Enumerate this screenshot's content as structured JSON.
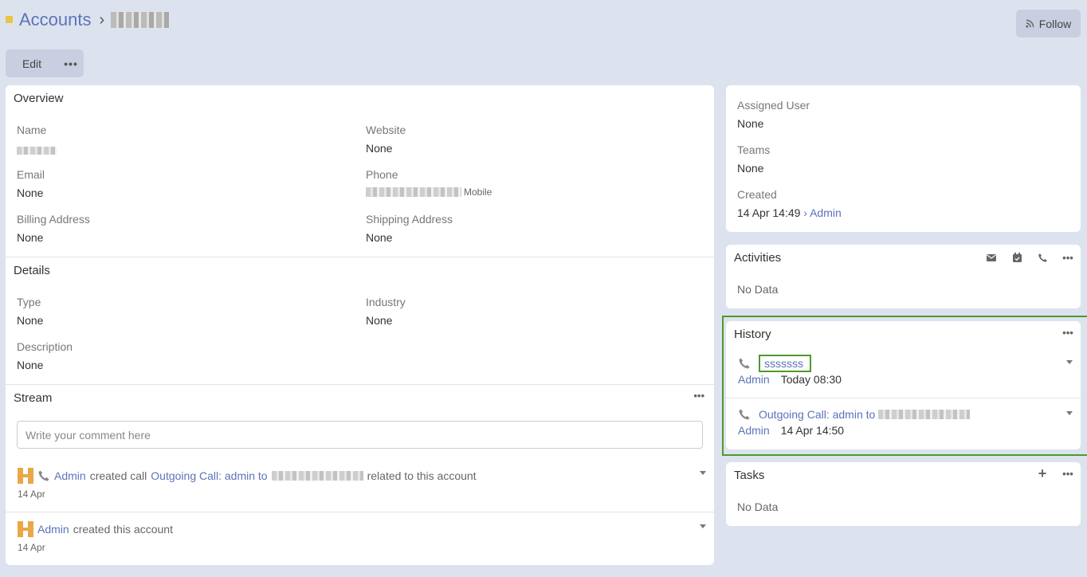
{
  "header": {
    "breadcrumb_root": "Accounts",
    "separator": "›",
    "follow_label": "Follow"
  },
  "toolbar": {
    "edit_label": "Edit",
    "more_label": "•••"
  },
  "overview": {
    "title": "Overview",
    "name_label": "Name",
    "website_label": "Website",
    "website_value": "None",
    "email_label": "Email",
    "email_value": "None",
    "phone_label": "Phone",
    "phone_type": "Mobile",
    "billing_label": "Billing Address",
    "billing_value": "None",
    "shipping_label": "Shipping Address",
    "shipping_value": "None"
  },
  "details": {
    "title": "Details",
    "type_label": "Type",
    "type_value": "None",
    "industry_label": "Industry",
    "industry_value": "None",
    "description_label": "Description",
    "description_value": "None"
  },
  "stream": {
    "title": "Stream",
    "comment_placeholder": "Write your comment here",
    "items": [
      {
        "user": "Admin",
        "action": "created call",
        "link": "Outgoing Call: admin to",
        "suffix": "related to this account",
        "date": "14 Apr"
      },
      {
        "user": "Admin",
        "action": "created this account",
        "date": "14 Apr"
      }
    ]
  },
  "side": {
    "assigned_label": "Assigned User",
    "assigned_value": "None",
    "teams_label": "Teams",
    "teams_value": "None",
    "created_label": "Created",
    "created_value": "14 Apr 14:49",
    "created_by": "› Admin"
  },
  "activities": {
    "title": "Activities",
    "empty": "No Data"
  },
  "history": {
    "title": "History",
    "items": [
      {
        "name": "sssssss",
        "user": "Admin",
        "time": "Today 08:30"
      },
      {
        "name": "Outgoing Call: admin to",
        "user": "Admin",
        "time": "14 Apr 14:50"
      }
    ]
  },
  "tasks": {
    "title": "Tasks",
    "empty": "No Data",
    "add_label": "+"
  },
  "colors": {
    "accent": "#5b73b9",
    "highlight": "#4e9a2c",
    "avatar": "#e8a849",
    "background": "#dde3ee"
  }
}
